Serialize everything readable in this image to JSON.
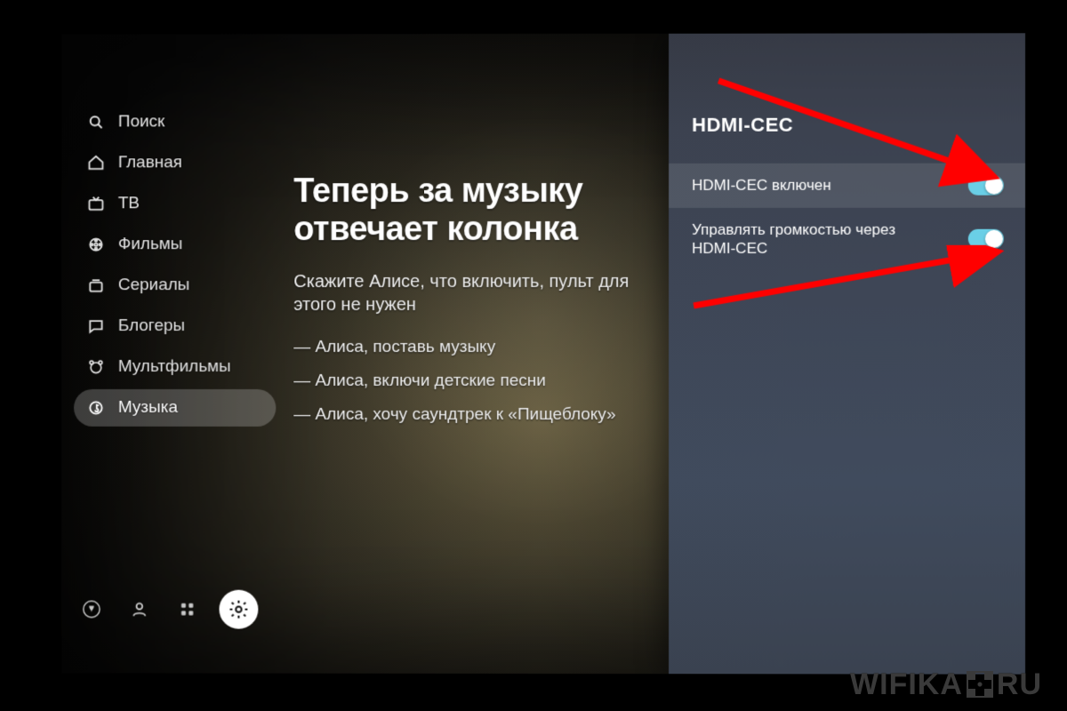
{
  "sidebar": {
    "items": [
      {
        "id": "search",
        "label": "Поиск",
        "icon": "search-icon"
      },
      {
        "id": "home",
        "label": "Главная",
        "icon": "home-icon"
      },
      {
        "id": "tv",
        "label": "ТВ",
        "icon": "tv-icon"
      },
      {
        "id": "films",
        "label": "Фильмы",
        "icon": "film-icon"
      },
      {
        "id": "series",
        "label": "Сериалы",
        "icon": "stack-icon"
      },
      {
        "id": "bloggers",
        "label": "Блогеры",
        "icon": "chat-icon"
      },
      {
        "id": "cartoons",
        "label": "Мультфильмы",
        "icon": "bear-icon"
      },
      {
        "id": "music",
        "label": "Музыка",
        "icon": "music-icon",
        "active": true
      }
    ]
  },
  "bottom_bar": {
    "assistant_icon": "assistant-icon",
    "profile_icon": "profile-icon",
    "apps_icon": "apps-icon",
    "settings_icon": "gear-icon",
    "settings_active": true
  },
  "promo": {
    "title_line1": "Теперь за музыку",
    "title_line2": "отвечает колонка",
    "subtitle": "Скажите Алисе, что включить, пульт для этого не нужен",
    "examples": [
      "— Алиса, поставь музыку",
      "— Алиса, включи детские песни",
      "— Алиса, хочу саундтрек к «Пищеблоку»"
    ]
  },
  "panel": {
    "title": "HDMI-CEC",
    "rows": [
      {
        "label": "HDMI-CEC включен",
        "enabled": true,
        "selected": true
      },
      {
        "label": "Управлять громкостью через HDMI-CEC",
        "enabled": true,
        "selected": false
      }
    ]
  },
  "annotations": {
    "arrow_color": "#ff0000"
  },
  "watermark": {
    "left": "WIFIKA",
    "right": "RU"
  }
}
